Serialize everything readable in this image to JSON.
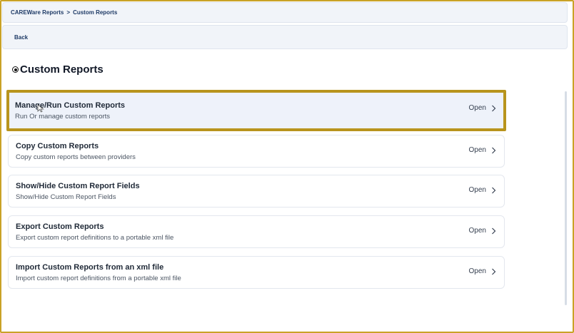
{
  "breadcrumb": {
    "items": [
      "CAREWare Reports",
      "Custom Reports"
    ],
    "separator": ">"
  },
  "back": {
    "label": "Back"
  },
  "page": {
    "title": "Custom Reports",
    "title_icon": "radio-target-icon"
  },
  "cards": [
    {
      "title": "Manage/Run Custom Reports",
      "description": "Run Or manage custom reports",
      "action": "Open",
      "highlighted": true
    },
    {
      "title": "Copy Custom Reports",
      "description": "Copy custom reports between providers",
      "action": "Open"
    },
    {
      "title": "Show/Hide Custom Report Fields",
      "description": "Show/Hide Custom Report Fields",
      "action": "Open"
    },
    {
      "title": "Export Custom Reports",
      "description": "Export custom report definitions to a portable xml file",
      "action": "Open"
    },
    {
      "title": "Import Custom Reports from an xml file",
      "description": "Import custom report definitions from a portable xml file",
      "action": "Open"
    }
  ],
  "colors": {
    "highlight_border": "#b8941d",
    "frame_border": "#c9a227",
    "link": "#1e3a66",
    "highlight_bg": "#eef2fa"
  }
}
